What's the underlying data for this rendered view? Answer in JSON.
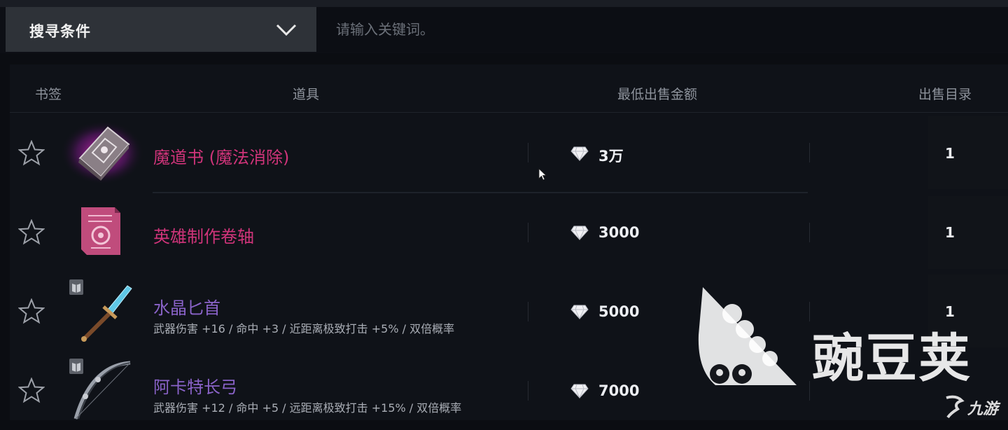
{
  "search": {
    "condition_label": "搜寻条件",
    "placeholder": "请输入关键词。"
  },
  "table": {
    "columns": [
      "书签",
      "道具",
      "最低出售金额",
      "出售目录"
    ],
    "rows": [
      {
        "name": "魔道书 (魔法消除)",
        "stats": "",
        "price": "3万",
        "count": "1",
        "name_color": "#d0347a"
      },
      {
        "name": "英雄制作卷轴",
        "stats": "",
        "price": "3000",
        "count": "1",
        "name_color": "#d0347a"
      },
      {
        "name": "水晶匕首",
        "stats": "武器伤害 +16 / 命中 +3 / 近距离极致打击 +5% / 双倍概率",
        "price": "5000",
        "count": "1",
        "name_color": "#8a63c9"
      },
      {
        "name": "阿卡特长弓",
        "stats": "武器伤害 +12 / 命中 +5 / 远距离极致打击 +15% / 双倍概率",
        "price": "7000",
        "count": "",
        "name_color": "#8a63c9"
      }
    ]
  },
  "watermarks": {
    "wandoujia": "豌豆荚",
    "jiuyou": "九游"
  },
  "icons": [
    "chevron-down-icon",
    "star-icon",
    "diamond-icon",
    "cursor-icon"
  ],
  "colors": {
    "legendary": "#d0347a",
    "epic": "#8a63c9",
    "background": "#0b0d12"
  }
}
